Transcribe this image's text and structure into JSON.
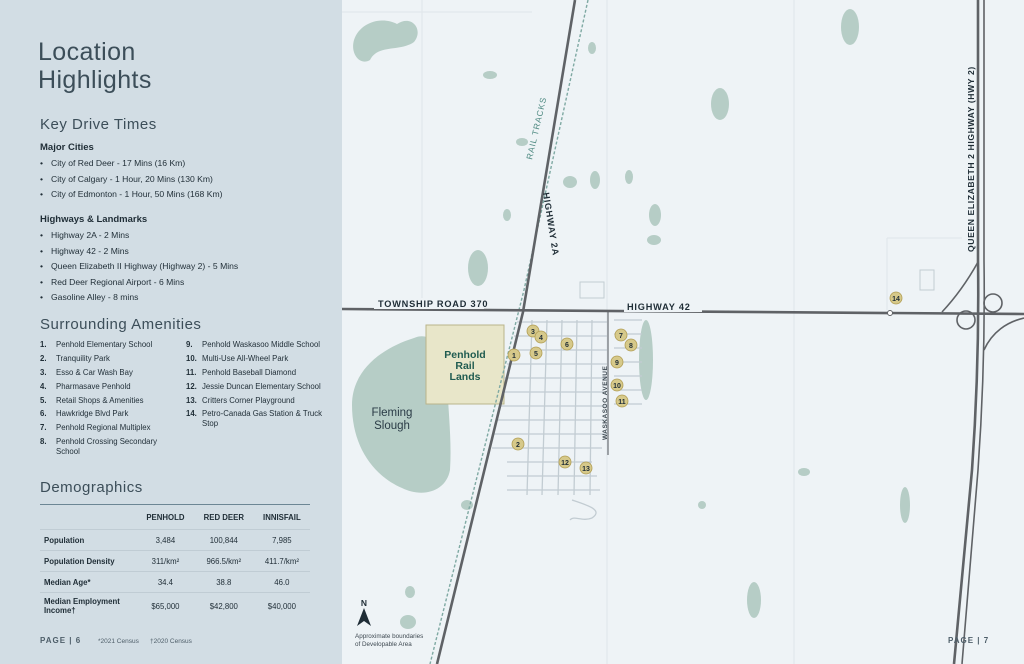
{
  "title": {
    "line1": "Location",
    "line2": "Highlights"
  },
  "drive_times": {
    "heading": "Key Drive Times",
    "major_cities_heading": "Major Cities",
    "major_cities": [
      "City of Red Deer - 17 Mins (16 Km)",
      "City of Calgary - 1 Hour, 20 Mins (130 Km)",
      "City of Edmonton - 1 Hour, 50 Mins (168 Km)"
    ],
    "highways_heading": "Highways & Landmarks",
    "highways": [
      "Highway 2A - 2 Mins",
      "Highway 42 - 2 Mins",
      "Queen Elizabeth II Highway (Highway 2) -  5 Mins",
      "Red Deer Regional Airport - 6 Mins",
      "Gasoline Alley - 8 mins"
    ]
  },
  "amenities": {
    "heading": "Surrounding Amenities",
    "col1": [
      {
        "num": "1.",
        "label": "Penhold Elementary School"
      },
      {
        "num": "2.",
        "label": "Tranquility Park"
      },
      {
        "num": "3.",
        "label": "Esso & Car Wash Bay"
      },
      {
        "num": "4.",
        "label": "Pharmasave Penhold"
      },
      {
        "num": "5.",
        "label": "Retail Shops & Amenities"
      },
      {
        "num": "6.",
        "label": "Hawkridge Blvd Park"
      },
      {
        "num": "7.",
        "label": "Penhold Regional Multiplex"
      },
      {
        "num": "8.",
        "label": "Penhold Crossing Secondary School"
      }
    ],
    "col2": [
      {
        "num": "9.",
        "label": "Penhold Waskasoo Middle School"
      },
      {
        "num": "10.",
        "label": "Multi-Use All-Wheel Park"
      },
      {
        "num": "11.",
        "label": "Penhold Baseball Diamond"
      },
      {
        "num": "12.",
        "label": "Jessie Duncan Elementary School"
      },
      {
        "num": "13.",
        "label": "Critters Corner Playground"
      },
      {
        "num": "14.",
        "label": "Petro-Canada Gas Station & Truck Stop"
      }
    ]
  },
  "demographics": {
    "heading": "Demographics",
    "columns": [
      "",
      "PENHOLD",
      "RED DEER",
      "INNISFAIL"
    ],
    "rows": [
      {
        "label": "Population",
        "values": [
          "3,484",
          "100,844",
          "7,985"
        ]
      },
      {
        "label": "Population Density",
        "values": [
          "311/km²",
          "966.5/km²",
          "411.7/km²"
        ]
      },
      {
        "label": "Median Age*",
        "values": [
          "34.4",
          "38.8",
          "46.0"
        ]
      },
      {
        "label": "Median Employment Income†",
        "values": [
          "$65,000",
          "$42,800",
          "$40,000"
        ]
      }
    ],
    "footnote1": "*2021 Census",
    "footnote2": "†2020 Census"
  },
  "footer": {
    "page_left": "PAGE | 6",
    "page_right": "PAGE | 7"
  },
  "map": {
    "site_label_lines": [
      "Penhold",
      "Rail",
      "Lands"
    ],
    "slough_label_lines": [
      "Fleming",
      "Slough"
    ],
    "road_township": "TOWNSHIP ROAD 370",
    "road_hwy42": "HIGHWAY 42",
    "road_hwy2a": "HIGHWAY 2A",
    "road_qe2": "QUEEN ELIZABETH 2 HIGHWAY (HWY 2)",
    "rail_label": "RAIL TRACKS",
    "waskasoo_label": "WASKASOO AVENUE",
    "north": "N",
    "note_lines": [
      "Approximate boundaries",
      "of Developable Area"
    ],
    "markers": [
      "1",
      "2",
      "3",
      "4",
      "5",
      "6",
      "7",
      "8",
      "9",
      "10",
      "11",
      "12",
      "13",
      "14"
    ],
    "colors": {
      "water": "#b6cdc6",
      "site": "#e8e6c9",
      "marker": "#d6c98a",
      "road": "#5f6266",
      "rail": "#7fa9a3",
      "background": "#eef3f6"
    }
  }
}
